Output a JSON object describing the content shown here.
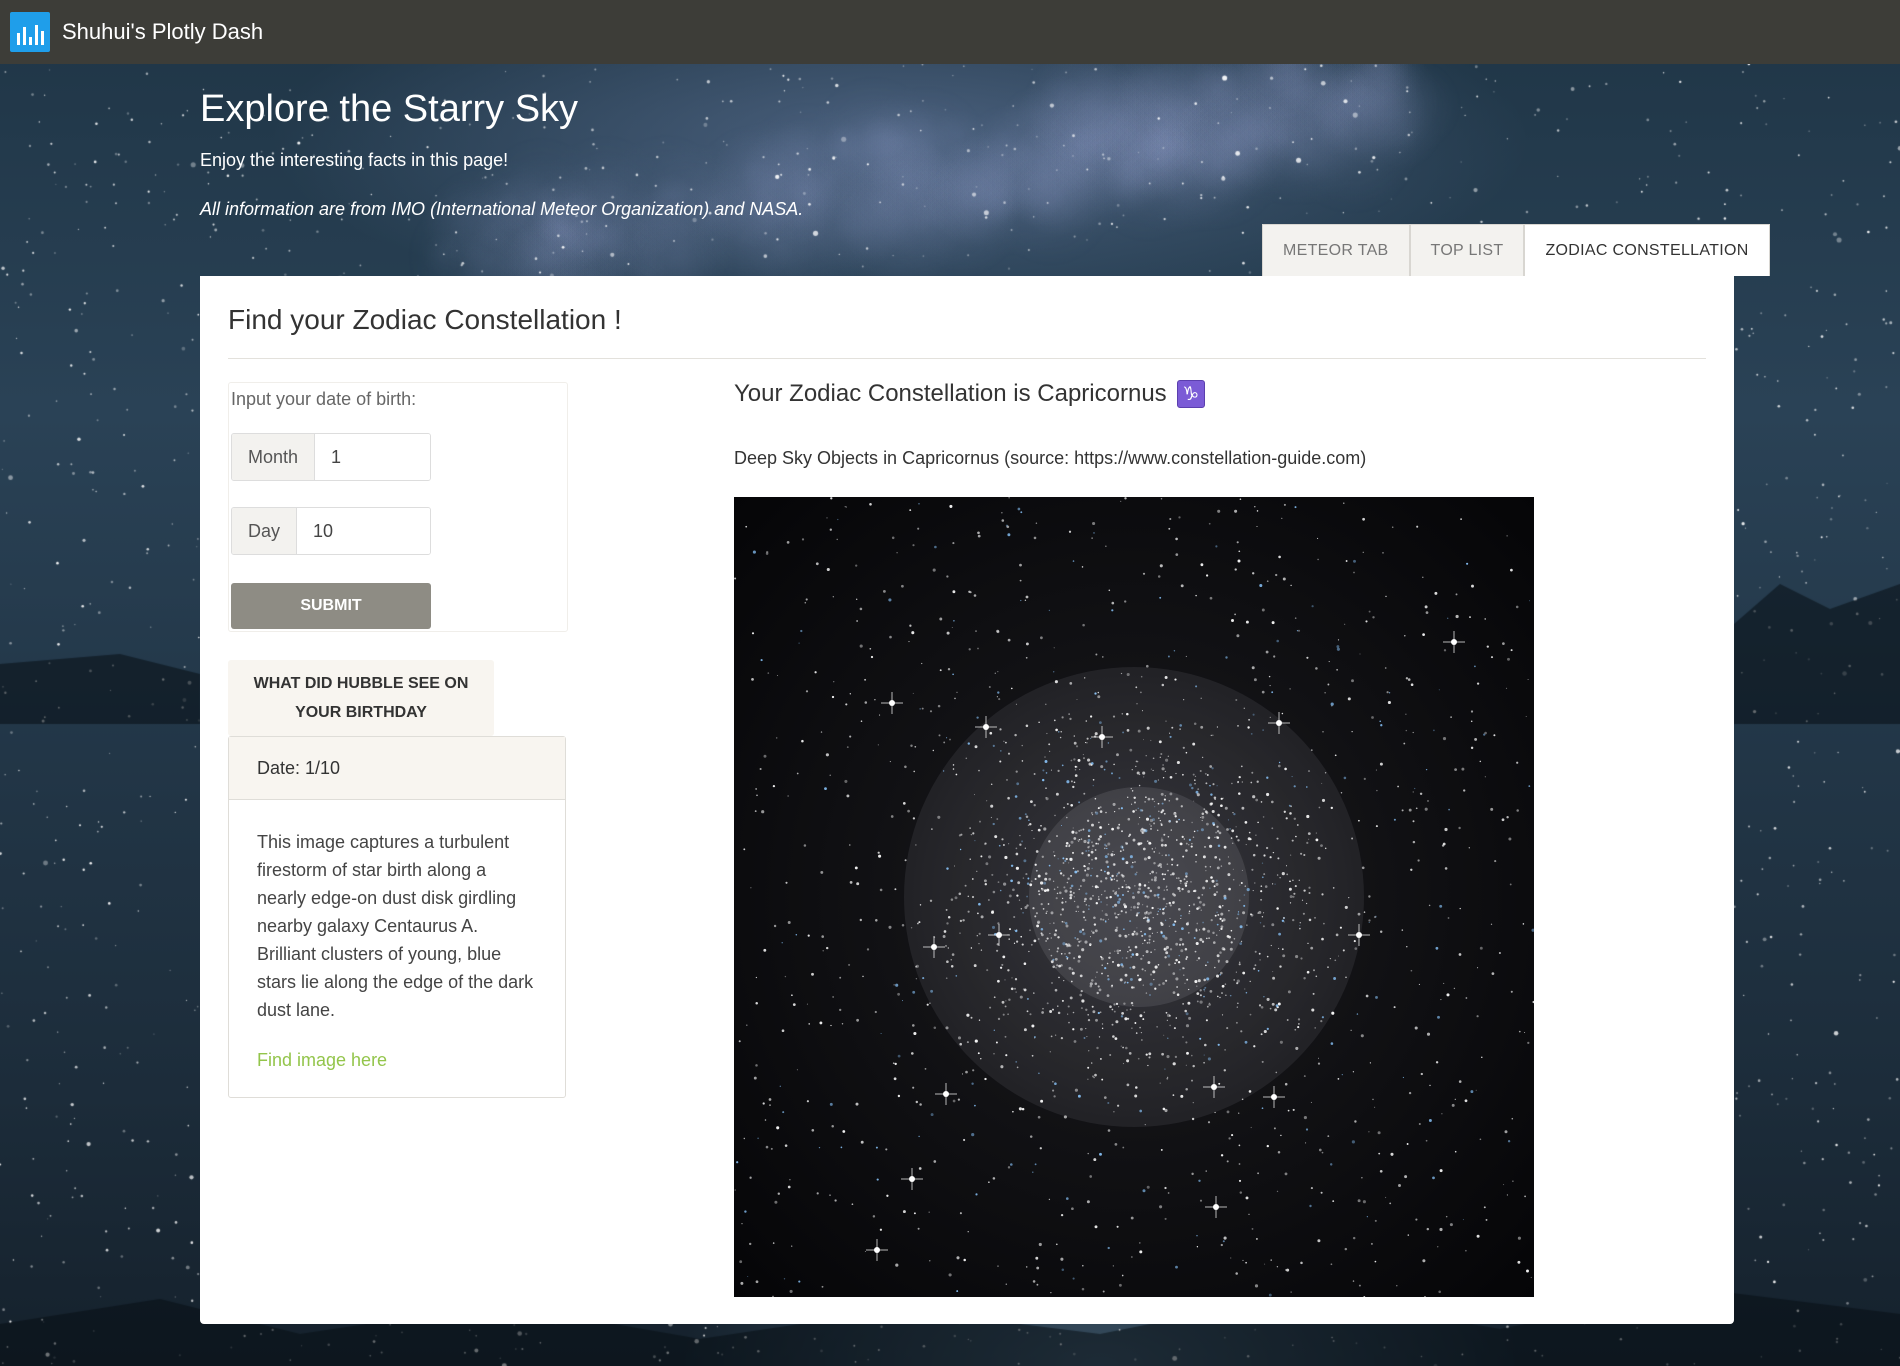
{
  "navbar": {
    "app_title": "Shuhui's Plotly Dash",
    "logo_icon": "plotly-bar-chart-icon"
  },
  "hero": {
    "title": "Explore the Starry Sky",
    "subtitle": "Enjoy the interesting facts in this page!",
    "note": "All information are from IMO (International Meteor Organization) and NASA."
  },
  "tabs": [
    {
      "label": "METEOR TAB",
      "active": false
    },
    {
      "label": "TOP LIST",
      "active": false
    },
    {
      "label": "ZODIAC CONSTELLATION",
      "active": true
    }
  ],
  "zodiac": {
    "heading": "Find your Zodiac Constellation !",
    "dob_label": "Input your date of birth:",
    "month_addon": "Month",
    "month_value": "1",
    "day_addon": "Day",
    "day_value": "10",
    "submit_label": "SUBMIT",
    "result_text": "Your Zodiac Constellation is Capricornus",
    "result_symbol": "♑",
    "deep_sky_caption": "Deep Sky Objects in Capricornus (source: https://www.constellation-guide.com)"
  },
  "hubble": {
    "button_label": "WHAT DID HUBBLE SEE ON YOUR BIRTHDAY",
    "date_label": "Date: 1/10",
    "description": "This image captures a turbulent firestorm of star birth along a nearly edge-on dust disk girdling nearby galaxy Centaurus A. Brilliant clusters of young, blue stars lie along the edge of the dark dust lane.",
    "link_label": "Find image here"
  },
  "colors": {
    "navbar_bg": "#3d3d38",
    "logo_blue": "#1f9eea",
    "submit_bg": "#8e8c84",
    "link_green": "#93c54b",
    "zodiac_symbol_bg": "#7b5bd6"
  }
}
